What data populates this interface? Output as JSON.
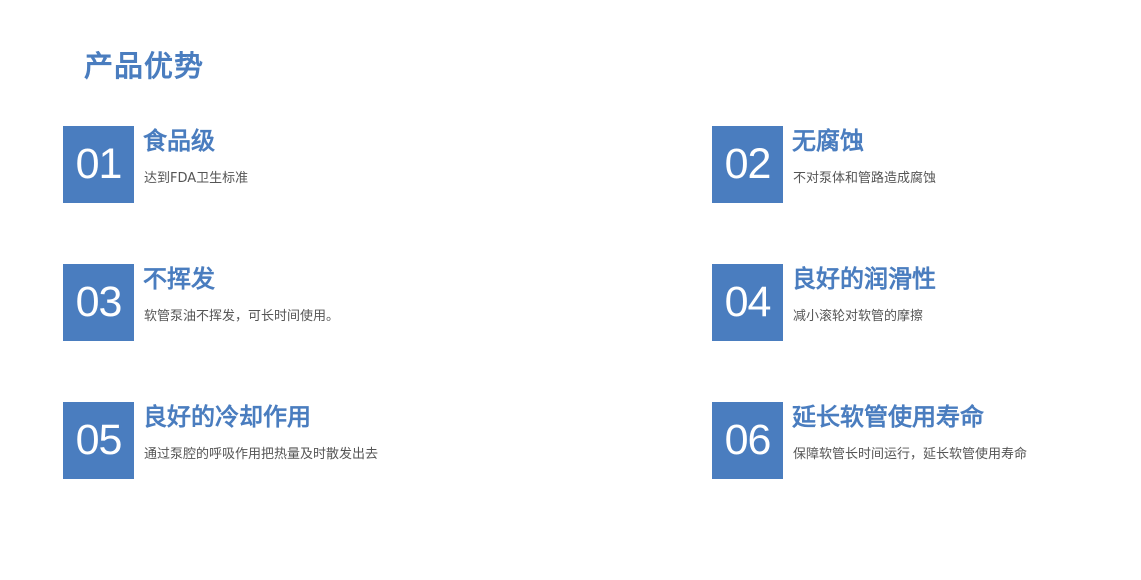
{
  "page": {
    "title": "产品优势"
  },
  "features": [
    {
      "num": "01",
      "title": "食品级",
      "desc": "达到FDA卫生标准"
    },
    {
      "num": "02",
      "title": "无腐蚀",
      "desc": "不对泵体和管路造成腐蚀"
    },
    {
      "num": "03",
      "title": "不挥发",
      "desc": "软管泵油不挥发，可长时间使用。"
    },
    {
      "num": "04",
      "title": "良好的润滑性",
      "desc": "减小滚轮对软管的摩擦"
    },
    {
      "num": "05",
      "title": "良好的冷却作用",
      "desc": "通过泵腔的呼吸作用把热量及时散发出去"
    },
    {
      "num": "06",
      "title": "延长软管使用寿命",
      "desc": "保障软管长时间运行，延长软管使用寿命"
    }
  ],
  "colors": {
    "accent": "#4a7dbf",
    "description_text": "#555555",
    "background": "#ffffff"
  }
}
